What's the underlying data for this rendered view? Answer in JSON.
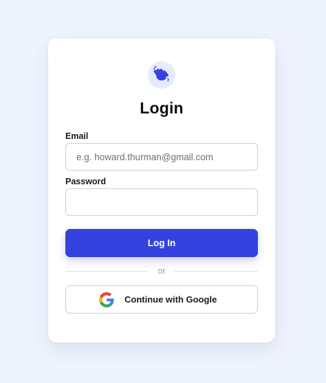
{
  "login": {
    "title": "Login",
    "email": {
      "label": "Email",
      "placeholder": "e.g. howard.thurman@gmail.com",
      "value": ""
    },
    "password": {
      "label": "Password",
      "value": ""
    },
    "submit_label": "Log In",
    "divider_text": "or",
    "google_label": "Continue with Google",
    "logo_icon": "waving-hand-icon",
    "google_icon": "google-g-icon"
  },
  "colors": {
    "background": "#eff3fe",
    "accent": "#3443e0",
    "logo_bg": "#e6ebfc"
  }
}
